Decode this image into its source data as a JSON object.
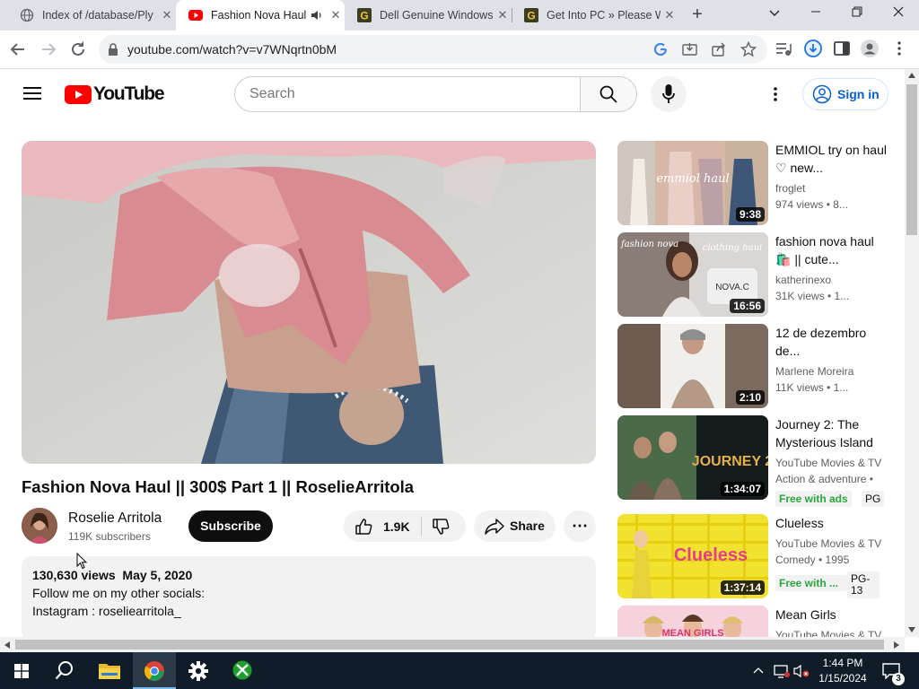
{
  "browser": {
    "tabs": [
      {
        "title": "Index of /database/Ply",
        "icon": "globe-icon",
        "active": false
      },
      {
        "title": "Fashion Nova Haul",
        "icon": "youtube-icon",
        "active": true,
        "audio": true
      },
      {
        "title": "Dell Genuine Windows",
        "icon": "g-logo-icon",
        "active": false
      },
      {
        "title": "Get Into PC » Please W",
        "icon": "g-logo-icon",
        "active": false
      }
    ],
    "url": "youtube.com/watch?v=v7WNqrtn0bM"
  },
  "youtube": {
    "logo_text": "YouTube",
    "search_placeholder": "Search",
    "signin_label": "Sign in"
  },
  "video": {
    "title": "Fashion Nova Haul || 300$ Part 1 || RoselieArritola",
    "channel": "Roselie Arritola",
    "subscribers": "119K subscribers",
    "subscribe_label": "Subscribe",
    "likes": "1.9K",
    "share_label": "Share",
    "views": "130,630 views",
    "date": "May 5, 2020",
    "description_lines": [
      "Follow me on my other socials:",
      "Instagram : roseliearritola_"
    ]
  },
  "recommendations": [
    {
      "title": "EMMIOL try on haul ♡ new...",
      "channel": "froglet",
      "meta": "974 views • 8...",
      "duration": "9:38",
      "thumb_text": "emmiol haul"
    },
    {
      "title": "fashion nova haul🛍️ || cute...",
      "channel": "katherinexo",
      "meta": "31K views • 1...",
      "duration": "16:56",
      "thumb_text": "fashion nova",
      "thumb_text2": "clothing haul"
    },
    {
      "title": "12 de dezembro de...",
      "channel": "Marlene Moreira",
      "meta": "11K views • 1...",
      "duration": "2:10"
    },
    {
      "title": "Journey 2: The Mysterious Island",
      "channel": "YouTube Movies & TV",
      "meta": "Action & adventure •",
      "duration": "1:34:07",
      "free_label": "Free with ads",
      "rating": "PG",
      "thumb_text": "JOURNEY 2"
    },
    {
      "title": "Clueless",
      "channel": "YouTube Movies & TV",
      "meta": "Comedy • 1995",
      "duration": "1:37:14",
      "free_label": "Free with ...",
      "rating": "PG-13",
      "thumb_text": "Clueless"
    },
    {
      "title": "Mean Girls",
      "channel": "YouTube Movies & TV",
      "thumb_text": "MEAN GIRLS"
    }
  ],
  "taskbar": {
    "time": "1:44 PM",
    "date": "1/15/2024",
    "notification_count": "3"
  },
  "colors": {
    "youtube_red": "#ff0000",
    "link_blue": "#065fd4",
    "free_green": "#2ba640",
    "taskbar": "#101c28"
  }
}
